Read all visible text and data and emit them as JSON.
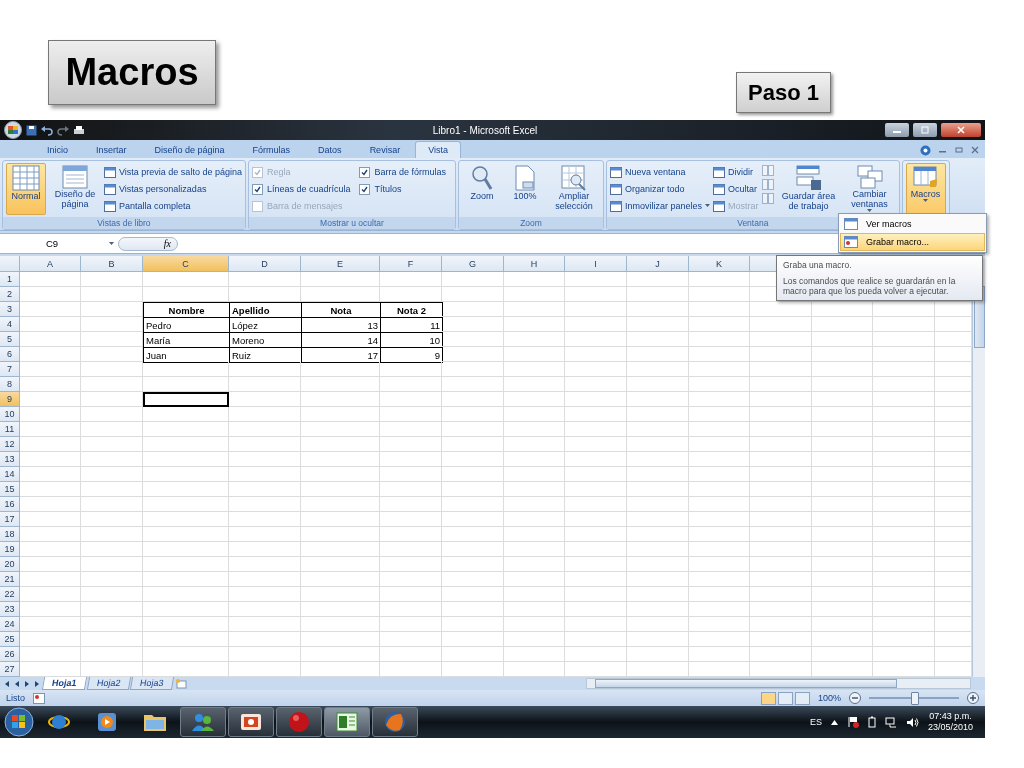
{
  "slide": {
    "title": "Macros",
    "step": "Paso 1"
  },
  "window": {
    "title": "Libro1 - Microsoft Excel"
  },
  "tabs": [
    {
      "label": "Inicio",
      "selected": false
    },
    {
      "label": "Insertar",
      "selected": false
    },
    {
      "label": "Diseño de página",
      "selected": false
    },
    {
      "label": "Fórmulas",
      "selected": false
    },
    {
      "label": "Datos",
      "selected": false
    },
    {
      "label": "Revisar",
      "selected": false
    },
    {
      "label": "Vista",
      "selected": true
    }
  ],
  "ribbon": {
    "groups": [
      {
        "label": "Vistas de libro",
        "items": [
          {
            "kind": "large",
            "label": "Normal",
            "selected": true,
            "dropdown": false
          },
          {
            "kind": "large",
            "label": "Diseño de página",
            "selected": false,
            "dropdown": false
          },
          {
            "kind": "stack",
            "entries": [
              {
                "label": "Vista previa de salto de página",
                "disabled": false,
                "dropdown": false
              },
              {
                "label": "Vistas personalizadas",
                "disabled": false,
                "dropdown": false
              },
              {
                "label": "Pantalla completa",
                "disabled": false,
                "dropdown": false
              }
            ]
          }
        ]
      },
      {
        "label": "Mostrar u ocultar",
        "items": [
          {
            "kind": "checks",
            "entries": [
              {
                "label": "Regla",
                "checked": true,
                "disabled": true
              },
              {
                "label": "Líneas de cuadrícula",
                "checked": true,
                "disabled": false
              },
              {
                "label": "Barra de mensajes",
                "checked": false,
                "disabled": true
              }
            ]
          },
          {
            "kind": "checks",
            "entries": [
              {
                "label": "Barra de fórmulas",
                "checked": true,
                "disabled": false
              },
              {
                "label": "Títulos",
                "checked": true,
                "disabled": false
              }
            ]
          }
        ]
      },
      {
        "label": "Zoom",
        "items": [
          {
            "kind": "large",
            "label": "Zoom",
            "selected": false,
            "dropdown": false
          },
          {
            "kind": "large",
            "label": "100%",
            "selected": false,
            "dropdown": false
          },
          {
            "kind": "large",
            "label": "Ampliar selección",
            "selected": false,
            "dropdown": false
          }
        ]
      },
      {
        "label": "Ventana",
        "items": [
          {
            "kind": "stack",
            "entries": [
              {
                "label": "Nueva ventana",
                "disabled": false,
                "dropdown": false
              },
              {
                "label": "Organizar todo",
                "disabled": false,
                "dropdown": false
              },
              {
                "label": "Inmovilizar paneles",
                "disabled": false,
                "dropdown": true
              }
            ]
          },
          {
            "kind": "stack",
            "entries": [
              {
                "label": "Dividir",
                "disabled": false,
                "dropdown": false
              },
              {
                "label": "Ocultar",
                "disabled": false,
                "dropdown": false
              },
              {
                "label": "Mostrar",
                "disabled": true,
                "dropdown": false
              }
            ]
          },
          {
            "kind": "icons",
            "entries": [
              {
                "disabled": true
              },
              {
                "disabled": true
              },
              {
                "disabled": true
              }
            ]
          },
          {
            "kind": "large",
            "label": "Guardar área de trabajo",
            "selected": false,
            "dropdown": false
          },
          {
            "kind": "large",
            "label": "Cambiar ventanas",
            "selected": false,
            "dropdown": true
          }
        ]
      },
      {
        "items": [
          {
            "kind": "large",
            "label": "Macros",
            "selected": true,
            "dropdown": true
          }
        ]
      }
    ]
  },
  "menu": {
    "items": [
      {
        "label": "Ver macros",
        "selected": false
      },
      {
        "label": "Grabar macro...",
        "selected": true
      }
    ]
  },
  "tooltip": {
    "title": "Graba una macro.",
    "body": "Los comandos que realice se guardarán en la macro para que los pueda volver a ejecutar."
  },
  "formula_bar": {
    "name_box": "C9",
    "function_label": "fx"
  },
  "grid": {
    "columns": [
      {
        "label": "A",
        "selected": false
      },
      {
        "label": "B",
        "selected": false
      },
      {
        "label": "C",
        "selected": true
      },
      {
        "label": "D",
        "selected": false
      },
      {
        "label": "E",
        "selected": false
      },
      {
        "label": "F",
        "selected": false
      },
      {
        "label": "G",
        "selected": false
      },
      {
        "label": "H",
        "selected": false
      },
      {
        "label": "I",
        "selected": false
      },
      {
        "label": "J",
        "selected": false
      },
      {
        "label": "K",
        "selected": false
      }
    ],
    "rows": [
      {
        "label": "1",
        "selected": false
      },
      {
        "label": "2",
        "selected": false
      },
      {
        "label": "3",
        "selected": false
      },
      {
        "label": "4",
        "selected": false
      },
      {
        "label": "5",
        "selected": false
      },
      {
        "label": "6",
        "selected": false
      },
      {
        "label": "7",
        "selected": false
      },
      {
        "label": "8",
        "selected": false
      },
      {
        "label": "9",
        "selected": true
      },
      {
        "label": "10",
        "selected": false
      },
      {
        "label": "11",
        "selected": false
      },
      {
        "label": "12",
        "selected": false
      },
      {
        "label": "13",
        "selected": false
      },
      {
        "label": "14",
        "selected": false
      },
      {
        "label": "15",
        "selected": false
      },
      {
        "label": "16",
        "selected": false
      },
      {
        "label": "17",
        "selected": false
      },
      {
        "label": "18",
        "selected": false
      },
      {
        "label": "19",
        "selected": false
      },
      {
        "label": "20",
        "selected": false
      },
      {
        "label": "21",
        "selected": false
      },
      {
        "label": "22",
        "selected": false
      },
      {
        "label": "23",
        "selected": false
      },
      {
        "label": "24",
        "selected": false
      },
      {
        "label": "25",
        "selected": false
      },
      {
        "label": "26",
        "selected": false
      },
      {
        "label": "27",
        "selected": false
      }
    ]
  },
  "table": {
    "rows": [
      [
        {
          "text": "Nombre",
          "kind": "heading"
        },
        {
          "text": "Apellido",
          "kind": "heading_left"
        },
        {
          "text": "Nota",
          "kind": "heading"
        },
        {
          "text": "Nota 2",
          "kind": "heading"
        }
      ],
      [
        {
          "text": "Pedro",
          "kind": "text"
        },
        {
          "text": "López",
          "kind": "text"
        },
        {
          "text": "13",
          "kind": "number"
        },
        {
          "text": "11",
          "kind": "number"
        }
      ],
      [
        {
          "text": "María",
          "kind": "text"
        },
        {
          "text": "Moreno",
          "kind": "text"
        },
        {
          "text": "14",
          "kind": "number"
        },
        {
          "text": "10",
          "kind": "number"
        }
      ],
      [
        {
          "text": "Juan",
          "kind": "text"
        },
        {
          "text": "Ruiz",
          "kind": "text"
        },
        {
          "text": "17",
          "kind": "number"
        },
        {
          "text": "9",
          "kind": "number"
        }
      ]
    ]
  },
  "sheets": [
    {
      "label": "Hoja1",
      "selected": true
    },
    {
      "label": "Hoja2",
      "selected": false
    },
    {
      "label": "Hoja3",
      "selected": false
    }
  ],
  "status_bar": {
    "text": "Listo",
    "views": [
      {
        "selected": true
      },
      {
        "selected": false
      },
      {
        "selected": false
      }
    ],
    "zoom": "100%",
    "zoom_slider": {
      "level": 0.5
    }
  },
  "taskbar": {
    "apps": [
      {
        "running": false,
        "selected": false
      },
      {
        "running": false,
        "selected": false
      },
      {
        "running": false,
        "selected": false
      },
      {
        "running": true,
        "selected": false
      },
      {
        "running": true,
        "selected": false
      },
      {
        "running": true,
        "selected": false
      },
      {
        "running": true,
        "selected": true
      },
      {
        "running": true,
        "selected": false
      }
    ],
    "language": "ES",
    "time": "07:43 p.m.",
    "date": "23/05/2010"
  }
}
